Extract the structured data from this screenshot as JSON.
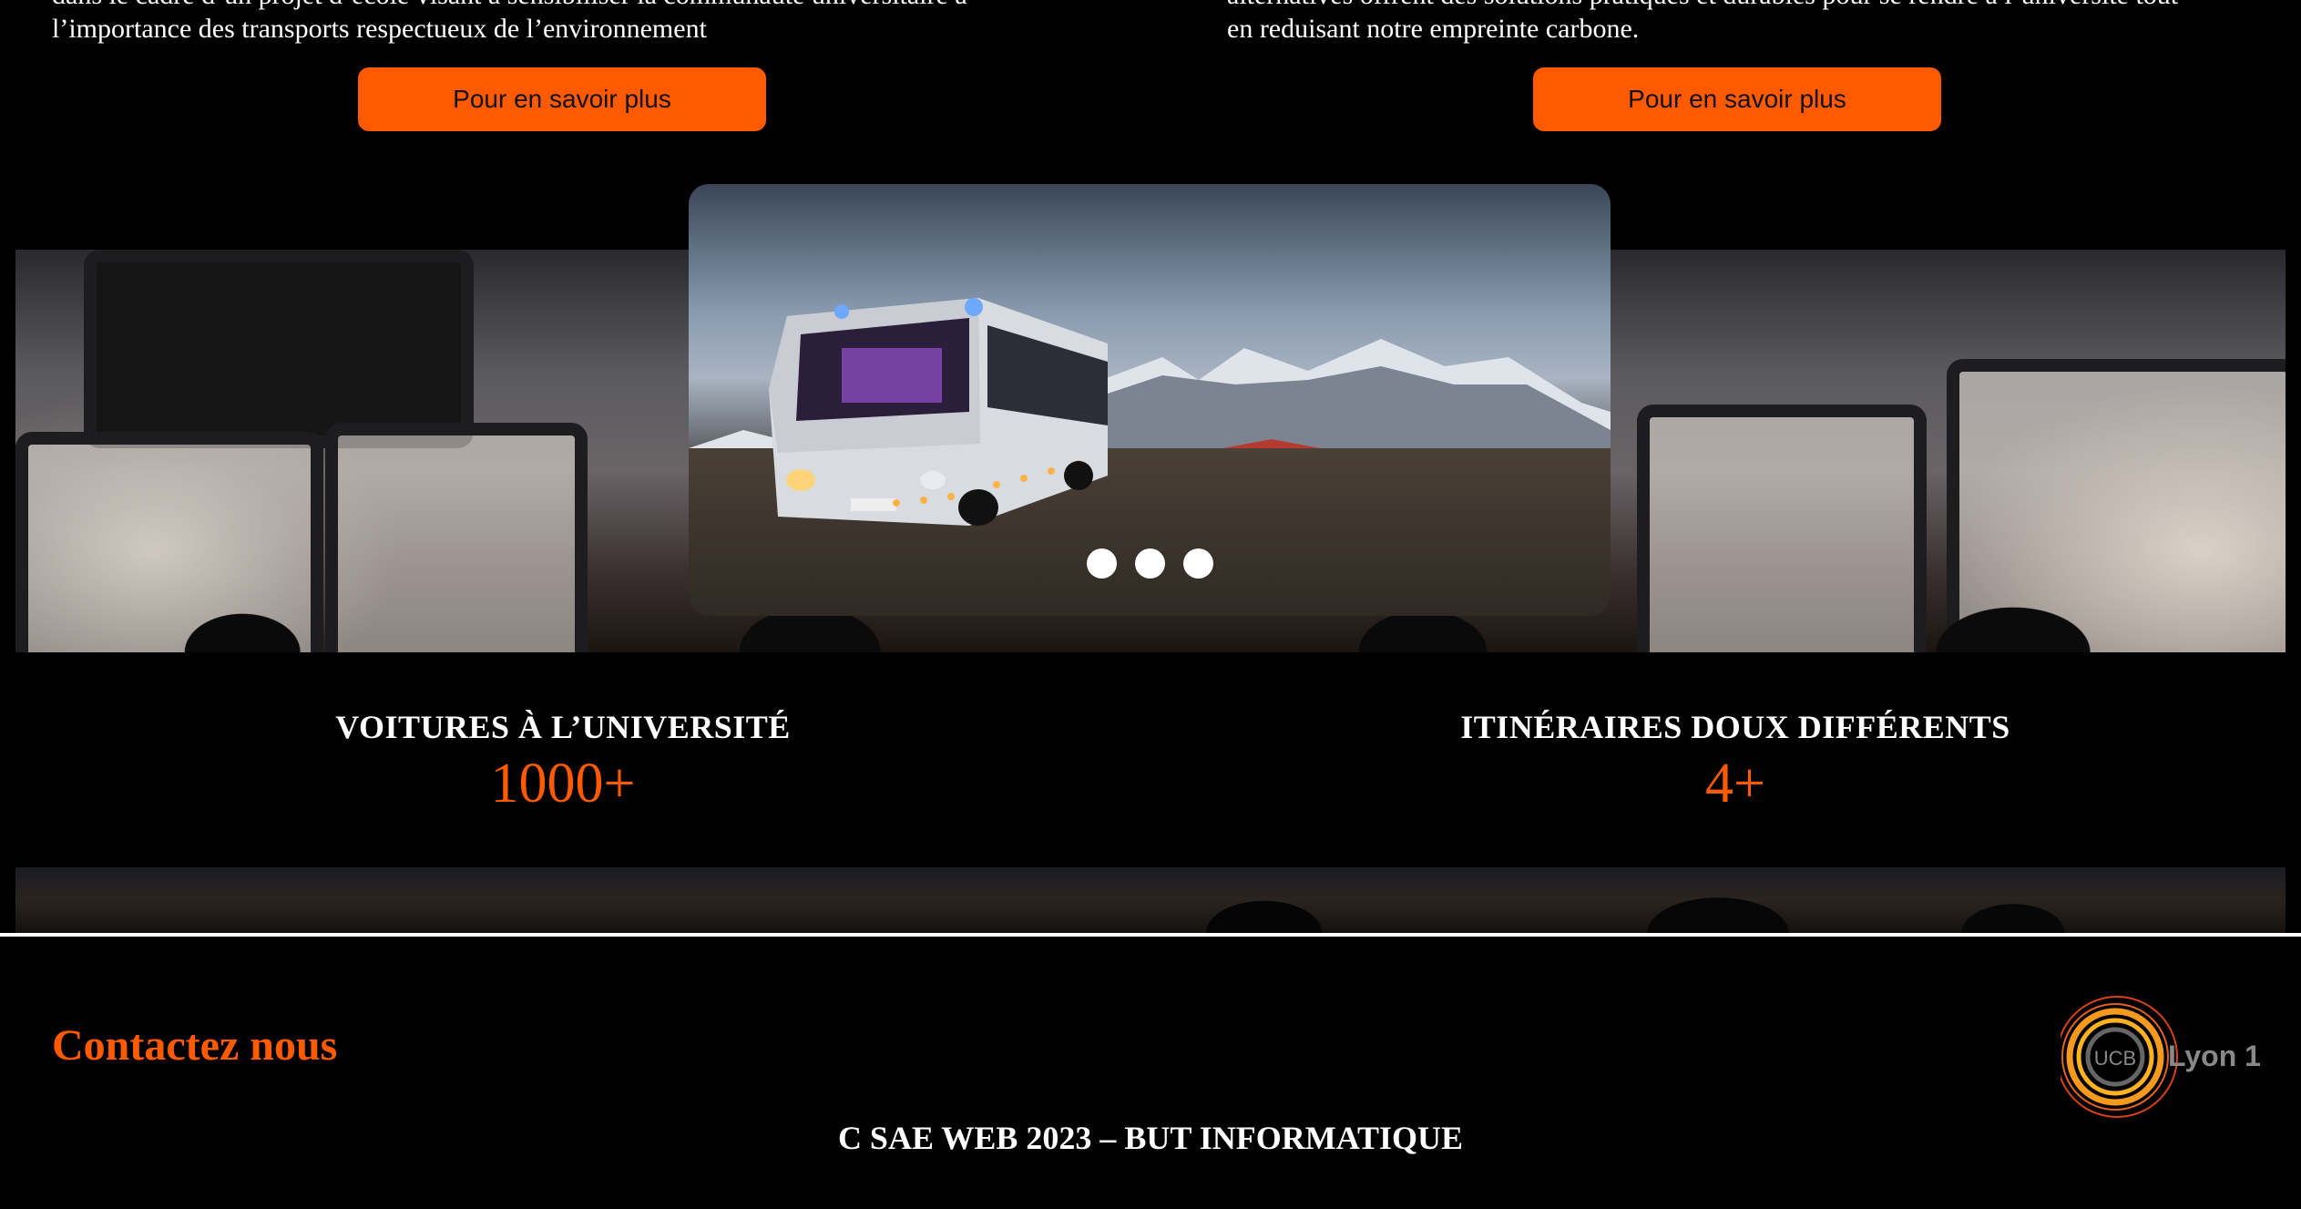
{
  "intro": {
    "left_cut": "dans le cadre d’un projet d’école visant à sensibiliser la communauté universitaire à",
    "left_line": "l’importance des transports respectueux de l’environnement",
    "right_cut": "alternatives offrent des solutions pratiques et durables pour se rendre à l’université tout",
    "right_line": "en reduisant notre empreinte carbone."
  },
  "buttons": {
    "left_label": "Pour en savoir plus",
    "right_label": "Pour en savoir plus"
  },
  "carousel": {
    "image": "bus-night-mountains-photo",
    "slides": 3
  },
  "stats": [
    {
      "label": "VOITURES À L’UNIVERSITÉ",
      "value": "1000+"
    },
    {
      "label": "ITINÉRAIRES DOUX DIFFÉRENTS",
      "value": "4+"
    }
  ],
  "footer": {
    "contact": "Contactez nous",
    "copyright": "C SAE WEB 2023 – BUT INFORMATIQUE",
    "logo_text": "Lyon 1",
    "logo_badge": "UCB"
  },
  "colors": {
    "accent": "#ff5a00",
    "background": "#000000",
    "text": "#ffffff"
  }
}
